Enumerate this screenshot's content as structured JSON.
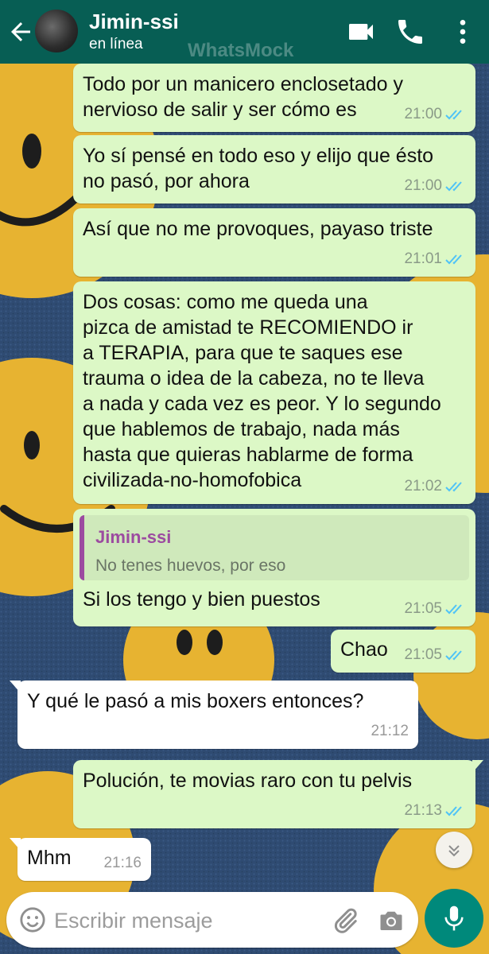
{
  "header": {
    "contact_name": "Jimin-ssi",
    "status": "en línea",
    "watermark": "WhatsMock",
    "icons": [
      "back-arrow-icon",
      "video-call-icon",
      "phone-icon",
      "more-vert-icon"
    ],
    "color": "#075e54"
  },
  "messages": [
    {
      "dir": "out",
      "text": "Todo por un manicero enclosetado y\nnervioso de salir y ser cómo es",
      "time": "21:00",
      "status": "read"
    },
    {
      "dir": "out",
      "text": "Yo sí pensé en todo eso y elijo que ésto\nno pasó, por ahora",
      "time": "21:00",
      "status": "read"
    },
    {
      "dir": "out",
      "text": "Así que no me provoques, payaso triste",
      "time": "21:01",
      "status": "read"
    },
    {
      "dir": "out",
      "text": "Dos cosas: como me queda una\npizca de amistad te RECOMIENDO ir\na TERAPIA, para que te saques ese\ntrauma o idea de la cabeza, no te lleva\na nada y cada vez es peor. Y lo segundo\nque hablemos de trabajo, nada más\nhasta que quieras hablarme de forma\ncivilizada-no-homofobica",
      "time": "21:02",
      "status": "read"
    },
    {
      "dir": "out",
      "quote_name": "Jimin-ssi",
      "quote_text": "No tenes huevos, por eso",
      "text": "Si los tengo y bien puestos",
      "time": "21:05",
      "status": "read"
    },
    {
      "dir": "out",
      "text": "Chao",
      "time": "21:05",
      "status": "read"
    },
    {
      "dir": "in",
      "text": "Y qué le pasó a mis boxers entonces?",
      "time": "21:12"
    },
    {
      "dir": "out",
      "text": "Polución, te movias raro con tu pelvis",
      "time": "21:13",
      "status": "read"
    },
    {
      "dir": "in",
      "text": "Mhm",
      "time": "21:16"
    }
  ],
  "composer": {
    "placeholder": "Escribir mensaje",
    "icons": [
      "emoji-icon",
      "attach-icon",
      "camera-icon",
      "mic-icon"
    ],
    "mic_color": "#00897b"
  },
  "colors": {
    "outgoing_bubble": "#dcf8c6",
    "incoming_bubble": "#ffffff",
    "read_ticks": "#4fc3f7",
    "quote_accent": "#9c4ba0"
  }
}
